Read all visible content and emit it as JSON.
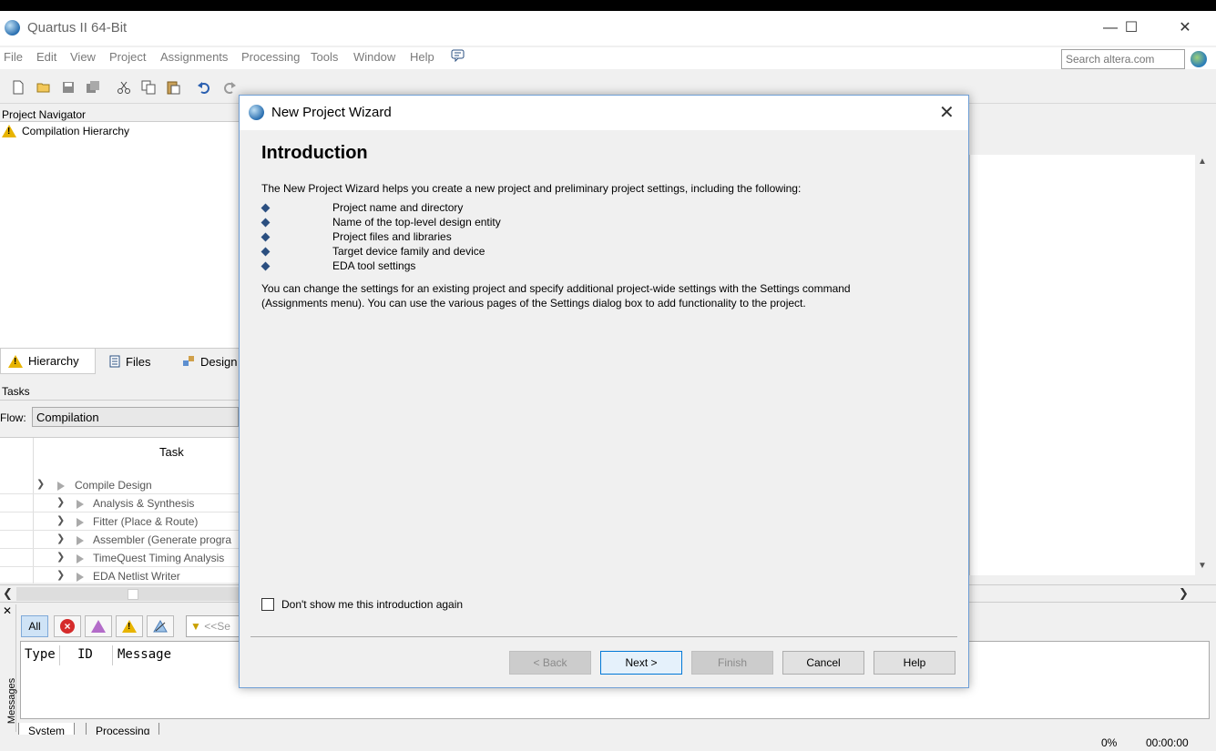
{
  "app": {
    "title": "Quartus II 64-Bit",
    "window_controls": {
      "minimize": "—",
      "maximize": "☐",
      "close": "✕"
    }
  },
  "menu": [
    "File",
    "Edit",
    "View",
    "Project",
    "Assignments",
    "Processing",
    "Tools",
    "Window",
    "Help"
  ],
  "search": {
    "placeholder": "Search altera.com"
  },
  "project_navigator": {
    "header": "Project Navigator",
    "item": "Compilation Hierarchy",
    "tabs": [
      "Hierarchy",
      "Files",
      "Design"
    ]
  },
  "tasks": {
    "header": "Tasks",
    "flow_label": "Flow:",
    "flow_value": "Compilation",
    "column": "Task",
    "rows": [
      {
        "label": "Compile Design",
        "expanded": true
      },
      {
        "label": "Analysis & Synthesis"
      },
      {
        "label": "Fitter (Place & Route)"
      },
      {
        "label": "Assembler (Generate progra"
      },
      {
        "label": "TimeQuest Timing Analysis"
      },
      {
        "label": "EDA Netlist Writer"
      }
    ]
  },
  "messages": {
    "side_label": "Messages",
    "filter_all": "All",
    "search_placeholder": "<<Se",
    "columns": [
      "Type",
      "ID",
      "Message"
    ],
    "tabs": [
      "System",
      "Processing"
    ]
  },
  "status": {
    "progress": "0%",
    "time": "00:00:00"
  },
  "dialog": {
    "title": "New Project Wizard",
    "heading": "Introduction",
    "intro": "The New Project Wizard helps you create a new project and preliminary project settings, including the following:",
    "bullets": [
      "Project name and directory",
      "Name of the top-level design entity",
      "Project files and libraries",
      "Target device family and device",
      "EDA tool settings"
    ],
    "note_line1": "You can change the settings for an existing project and specify additional project-wide settings with the Settings command",
    "note_line2": "(Assignments menu). You can use the various pages of the Settings dialog box to add functionality to the project.",
    "checkbox_label": "Don't show me this introduction again",
    "buttons": {
      "back": "< Back",
      "next": "Next >",
      "finish": "Finish",
      "cancel": "Cancel",
      "help": "Help"
    }
  },
  "colors": {
    "dialog_border": "#6f9fd6",
    "primary_button_border": "#0078d7",
    "warning": "#e8b400",
    "error": "#d52b2b"
  }
}
